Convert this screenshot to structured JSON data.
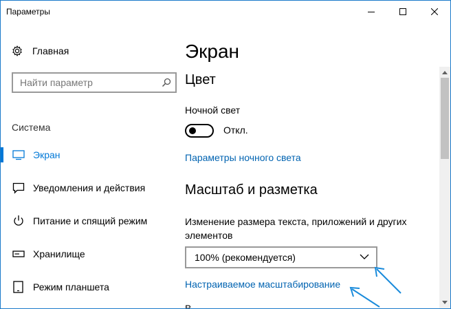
{
  "window": {
    "title": "Параметры",
    "accent": "#0078d7",
    "link_color": "#0063b1"
  },
  "sidebar": {
    "home_label": "Главная",
    "home_icon": "gear-icon",
    "search_placeholder": "Найти параметр",
    "section": "Система",
    "items": [
      {
        "label": "Экран",
        "icon": "monitor-icon",
        "active": true
      },
      {
        "label": "Уведомления и действия",
        "icon": "message-icon",
        "active": false
      },
      {
        "label": "Питание и спящий режим",
        "icon": "power-icon",
        "active": false
      },
      {
        "label": "Хранилище",
        "icon": "storage-icon",
        "active": false
      },
      {
        "label": "Режим планшета",
        "icon": "tablet-icon",
        "active": false
      }
    ]
  },
  "main": {
    "title": "Экран",
    "color_heading": "Цвет",
    "night_light_label": "Ночной свет",
    "night_light_state": "Откл.",
    "night_light_on": false,
    "night_light_link": "Параметры ночного света",
    "scale_heading": "Масштаб и разметка",
    "scale_description": "Изменение размера текста, приложений и других элементов",
    "scale_value": "100% (рекомендуется)",
    "custom_scaling_link": "Настраиваемое масштабирование"
  }
}
